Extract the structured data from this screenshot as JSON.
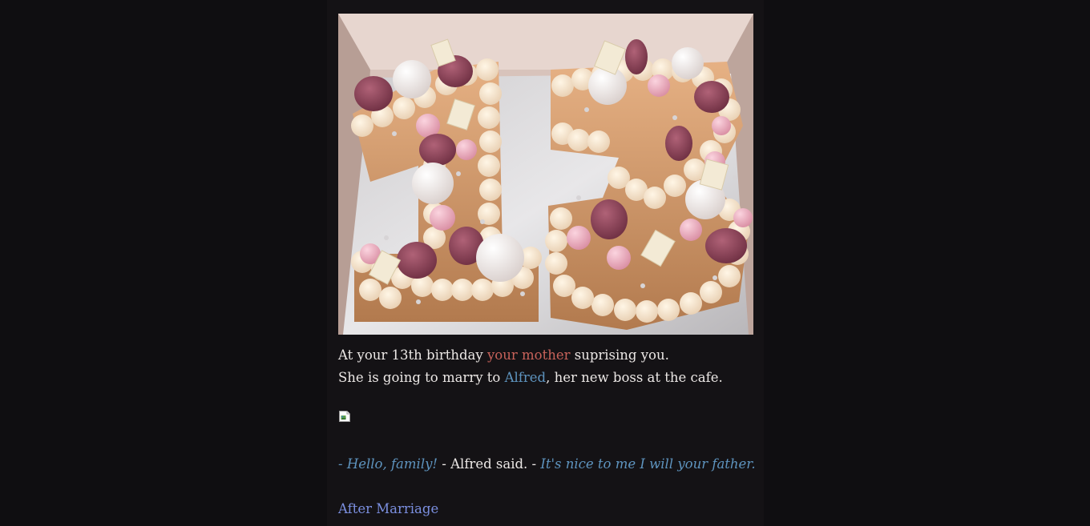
{
  "hero": {
    "alt": "Number 13 birthday cake decorated with macarons and meringues"
  },
  "passage": {
    "line1": {
      "before": "At your 13th birthday ",
      "highlight": "your mother",
      "after": " suprising you."
    },
    "line2": {
      "before": "She is going to marry to ",
      "highlight": "Alfred",
      "after": ", her new boss at the cafe."
    }
  },
  "dialogue": {
    "speech1": "- Hello, family!",
    "narration": " - Alfred said. - ",
    "speech2": "It's nice to me I will your father."
  },
  "link": {
    "label": "After Marriage"
  },
  "colors": {
    "background": "#0f0e11",
    "column": "#141215",
    "text": "#ece8e6",
    "highlight_red": "#c8625a",
    "highlight_blue": "#5e94bf",
    "link": "#7b8fe0"
  }
}
